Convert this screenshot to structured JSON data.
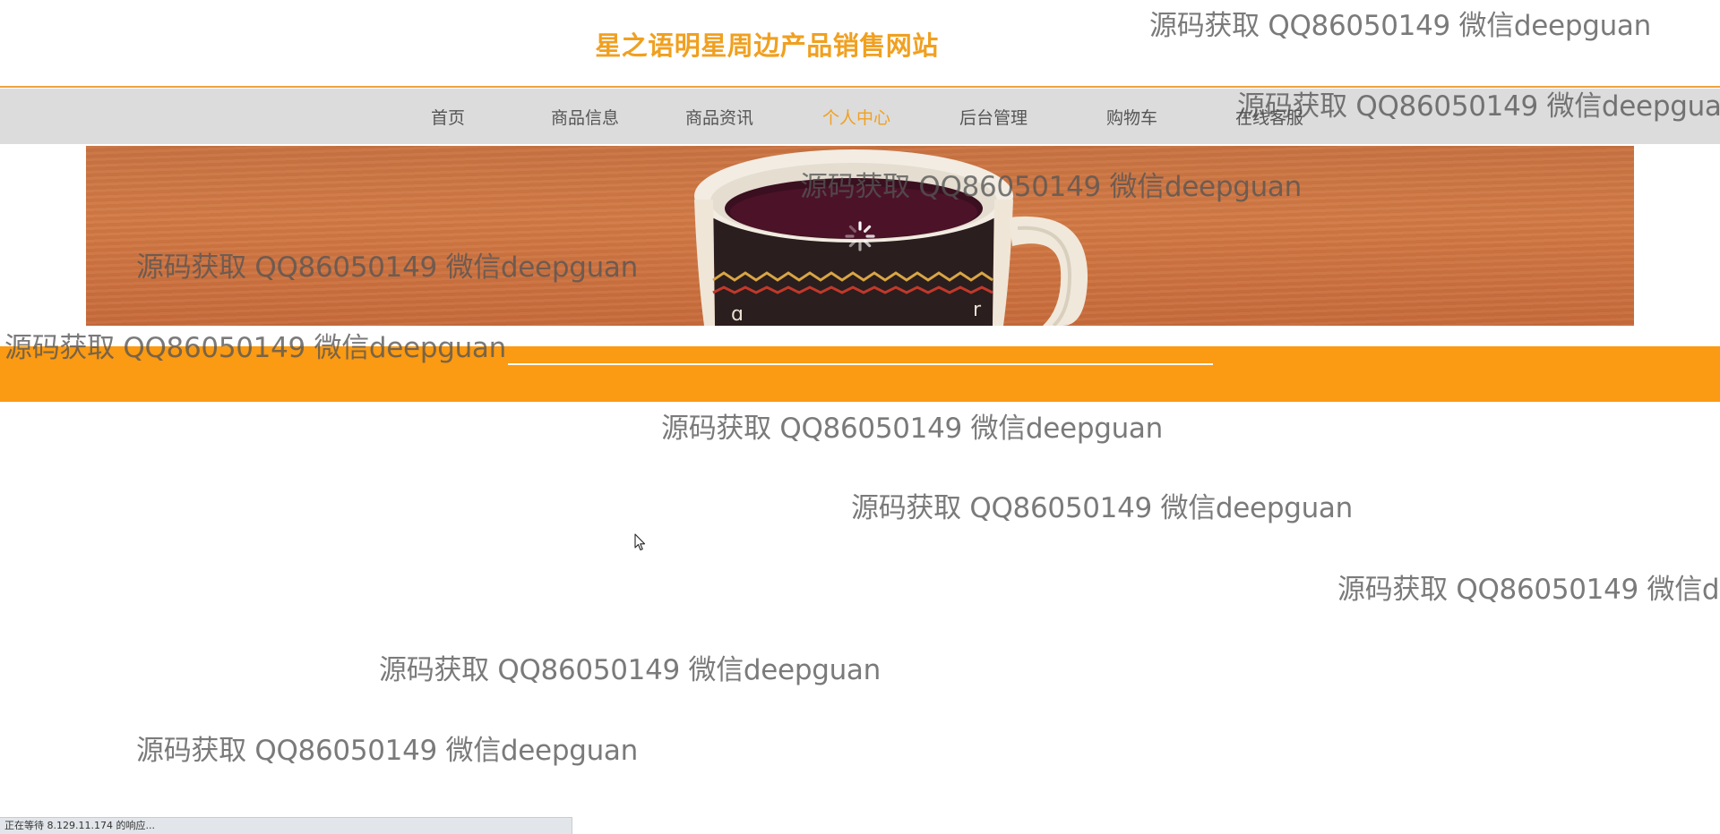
{
  "site": {
    "title": "星之语明星周边产品销售网站"
  },
  "nav": {
    "items": [
      {
        "label": "首页"
      },
      {
        "label": "商品信息"
      },
      {
        "label": "商品资讯"
      },
      {
        "label": "个人中心",
        "active": true
      },
      {
        "label": "后台管理"
      },
      {
        "label": "购物车"
      },
      {
        "label": "在线客服"
      }
    ],
    "active_color": "#f0a020"
  },
  "watermark": {
    "text": "源码获取 QQ86050149 微信deepguan",
    "truncated_text": "源码获取 QQ86050149 微信de"
  },
  "banner": {
    "image": "coffee-mug-on-wooden-table",
    "loading_icon": "spinner-icon"
  },
  "colors": {
    "accent": "#fb9a13",
    "title": "#f0a020",
    "nav_bg": "#dcdcdc"
  },
  "status_bar": {
    "text": "正在等待 8.129.11.174 的响应..."
  }
}
